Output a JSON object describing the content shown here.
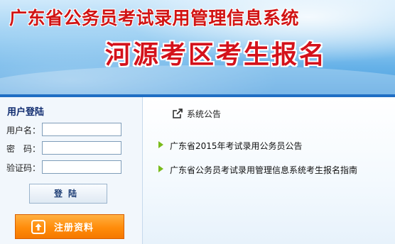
{
  "header": {
    "system_title": "广东省公务员考试录用管理信息系统",
    "region_title": "河源考区考生报名"
  },
  "login": {
    "title": "用户登陆",
    "username_label": "用户名：",
    "password_label": "密　码：",
    "captcha_label": "验证码：",
    "username_value": "",
    "password_value": "",
    "captcha_value": "",
    "login_button": "登陆",
    "register_button": "注册资料",
    "register_icon": "upload-icon"
  },
  "notices": {
    "heading": "系统公告",
    "heading_icon": "external-link-icon",
    "items": [
      {
        "title": "广东省2015年考试录用公务员公告"
      },
      {
        "title": "广东省公务员考试录用管理信息系统考生报名指南"
      }
    ]
  },
  "colors": {
    "title_red": "#d11414",
    "divider_blue": "#1f6ec4",
    "register_orange": "#ff8c0a",
    "bullet_green": "#79bb1a"
  }
}
